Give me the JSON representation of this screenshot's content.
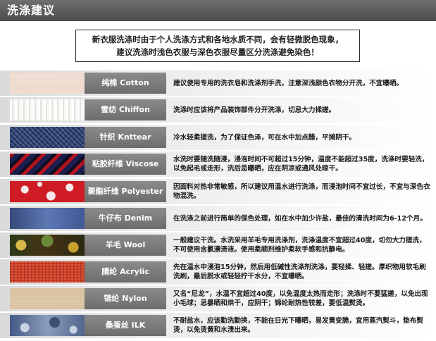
{
  "header": {
    "title": "洗涤建议"
  },
  "notice": {
    "line1": "新衣服洗涤时由于个人洗涤方式和各地水质不同，会有轻微脱色现象，",
    "line2": "建议洗涤时浅色衣服与深色衣服尽量区分洗涤避免染色！"
  },
  "fabrics": [
    {
      "label": "纯棉 Cotton",
      "icon": "cotton-swatch",
      "description": "建议使用专用的洗衣皂和洗涤剂手洗，注意深浅颜色衣物分开洗，不宜曝晒。"
    },
    {
      "label": "雪纺 Chiffon",
      "icon": "chiffon-swatch",
      "description": "洗涤时应该将产品装饰部件分开洗涤，切忌大力揉搓。"
    },
    {
      "label": "针织 Knttear",
      "icon": "knit-swatch",
      "description": "冷水轻柔搓洗，为了保证色泽，可在水中加点醋，平摊阴干。"
    },
    {
      "label": "粘胶纤维 Viscose",
      "icon": "viscose-swatch",
      "description": "水洗时要随洗随浸，浸泡时间不可超过15分钟，温度不能超过35度，洗涤时要轻洗，以免起毛或走形，洗后忌曝晒，应在阴凉或通风处晾干。"
    },
    {
      "label": "聚酯纤维 Polyester",
      "icon": "polyester-swatch",
      "description": "因面料对热非常敏感，所以建议用温水进行洗涤，而浸泡时间不宜过长，不宜与深色衣物混洗。"
    },
    {
      "label": "牛仔布 Denim",
      "icon": "denim-swatch",
      "description": "在洗涤之前进行简单的保色处理，如在水中加少许盐，最佳的清洗时间为6-12个月。"
    },
    {
      "label": "羊毛 Wool",
      "icon": "wool-swatch",
      "description": "一般建议干洗。水洗采用羊毛专用洗涤剂，洗涤温度不宜超过40度，切勿大力搓洗，不可使用含氯漂渍液。使用柔顺剂维护柔软手感和抗静电。"
    },
    {
      "label": "腈纶 Acrylic",
      "icon": "acrylic-swatch",
      "description": "先在温水中浸泡15分钟，然后用低碱性洗涤剂洗涤，要轻揉、轻搓。厚织物用软毛刷洗刷，最后脱水或轻轻拧干水分，不宜曝晒。"
    },
    {
      "label": "锦纶 Nylon",
      "icon": "nylon-swatch",
      "description": "又名“尼龙”，水温不宜超过40度，以免温度太热而走形；洗涤时不要猛搓，以免出现小毛球；忌暴晒和烘干，应阴干；锦纶耐热性较差，要低温熨烫。"
    },
    {
      "label": "桑蚕丝 ILK",
      "icon": "silk-swatch",
      "description": "不耐盐水，应该勤洗勤换，不能在日光下曝晒，易发黄变脆，宜用蒸汽熨斗，垫布熨烫，以免烫黄和水渍出来。"
    }
  ]
}
